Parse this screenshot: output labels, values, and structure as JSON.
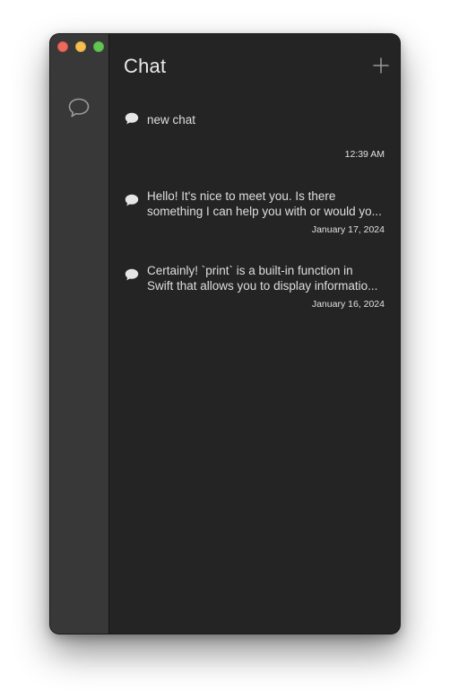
{
  "window": {
    "title": "Chat"
  },
  "sidebar": {
    "icon": "chat-bubble-outline-icon"
  },
  "header": {
    "title": "Chat",
    "add_icon": "plus-icon"
  },
  "chats": [
    {
      "line1": "new chat",
      "line2": "",
      "date": "12:39 AM"
    },
    {
      "line1": "Hello! It's nice to meet you. Is there",
      "line2": "something I can help you with or would yo...",
      "date": "January 17, 2024"
    },
    {
      "line1": "Certainly! `print` is a built-in function in",
      "line2": "Swift that allows you to display informatio...",
      "date": "January 16, 2024"
    }
  ],
  "colors": {
    "window_bg": "#242424",
    "sidebar_bg": "#383838",
    "text": "#dedede"
  }
}
